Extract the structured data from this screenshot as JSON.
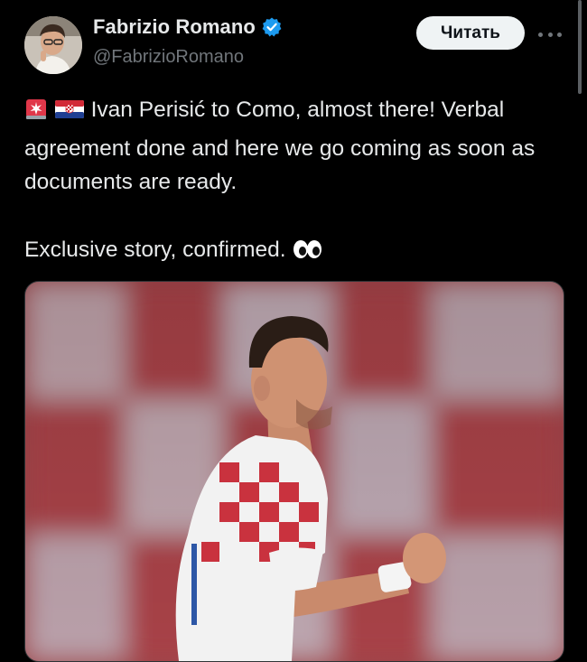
{
  "author": {
    "name": "Fabrizio Romano",
    "handle": "@FabrizioRomano",
    "verified_color": "#1d9bf0",
    "avatar_icon": "profile-photo"
  },
  "actions": {
    "follow_label": "Читать",
    "more_icon": "more-horizontal-icon"
  },
  "tweet": {
    "line1_emojis": [
      "rotating-light-emoji",
      "croatia-flag-emoji"
    ],
    "line1_text": " Ivan Perisić to Como, almost there! Verbal agreement done and here we go coming as soon as documents are ready.",
    "line2_text": "Exclusive story, confirmed. ",
    "line2_emoji": "eyes-emoji"
  },
  "media": {
    "type": "photo",
    "description_icon": "player-photo"
  },
  "colors": {
    "background": "#000000",
    "text": "#e7e9ea",
    "secondary": "#71767b",
    "accent": "#1d9bf0",
    "button_bg": "#eff3f4"
  }
}
